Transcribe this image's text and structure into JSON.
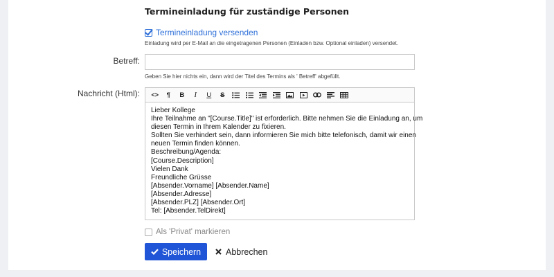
{
  "section": {
    "title": "Termineinladung für zuständige Personen"
  },
  "invite": {
    "checked": true,
    "label": "Termineinladung versenden",
    "hint": "Einladung wird per E-Mail an die eingetragenen Personen (Einladen bzw. Optional einladen) versendet."
  },
  "subject": {
    "label": "Betreff:",
    "value": "",
    "hint": "Geben Sie hier nichts ein, dann wird der Titel des Termins als ' Betreff' abgefüllt."
  },
  "message": {
    "label": "Nachricht (Html):",
    "toolbar": {
      "code": "<>",
      "paragraph": "¶",
      "bold": "B",
      "italic": "I",
      "underline": "U",
      "strike": "S"
    },
    "lines": [
      "Lieber Kollege",
      "Ihre Teilnahme an \"[Course.Title]\" ist erforderlich. Bitte nehmen Sie die Einladung an, um",
      "diesen Termin in Ihrem Kalender zu fixieren.",
      "Sollten Sie verhindert sein, dann informieren Sie mich bitte telefonisch, damit wir einen",
      "neuen Termin finden können.",
      "Beschreibung/Agenda:",
      "[Course.Description]",
      "Vielen Dank",
      "Freundliche Grüsse",
      "[Absender.Vorname] [Absender.Name]",
      "[Absender.Adresse]",
      "[Absender.PLZ] [Absender.Ort]",
      "Tel: [Absender.TelDirekt]"
    ]
  },
  "private": {
    "checked": false,
    "label": "Als 'Privat' markieren"
  },
  "actions": {
    "save_label": "Speichern",
    "cancel_label": "Abbrechen"
  },
  "colors": {
    "accent": "#1f55d6",
    "link": "#2d6fd8"
  }
}
